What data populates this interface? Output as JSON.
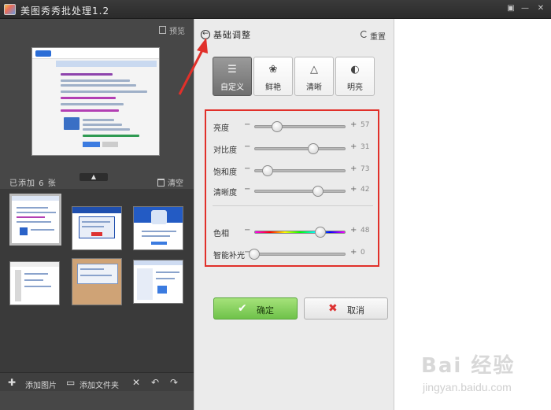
{
  "window": {
    "title": "美图秀秀批处理1.2",
    "controls": [
      "▣",
      "—",
      "✕"
    ]
  },
  "left": {
    "preview_label": "预览",
    "collapse_glyph": "▲",
    "count_label": "已添加 6 张",
    "clear_label": "清空",
    "bottom": {
      "add_image": "添加图片",
      "add_folder": "添加文件夹",
      "close_glyph": "✕",
      "undo_glyph": "↶",
      "redo_glyph": "↷"
    }
  },
  "panel": {
    "title": "基础调整",
    "reset_label": "重置",
    "back_glyph": "←",
    "modes": [
      {
        "label": "自定义",
        "icon": "sliders-icon",
        "glyph": "☰",
        "active": true
      },
      {
        "label": "鲜艳",
        "icon": "flower-icon",
        "glyph": "❀",
        "active": false
      },
      {
        "label": "清晰",
        "icon": "triangle-icon",
        "glyph": "△",
        "active": false
      },
      {
        "label": "明亮",
        "icon": "contrast-icon",
        "glyph": "◐",
        "active": false
      }
    ],
    "sliders": [
      {
        "name": "亮度",
        "value": "57",
        "level": 0.25
      },
      {
        "name": "对比度",
        "value": "31",
        "level": 0.65
      },
      {
        "name": "饱和度",
        "value": "73",
        "level": 0.15
      },
      {
        "name": "清晰度",
        "value": "42",
        "level": 0.7
      },
      {
        "name": "色相",
        "value": "48",
        "level": 0.72
      },
      {
        "name": "智能补光",
        "value": "0",
        "level": 0.0
      }
    ],
    "ok_label": "确定",
    "cancel_label": "取消"
  },
  "watermark": {
    "logo": "Bai 经验",
    "url": "jingyan.baidu.com"
  },
  "colors": {
    "accent_red": "#e1302a",
    "ok_green": "#6fc24a"
  }
}
